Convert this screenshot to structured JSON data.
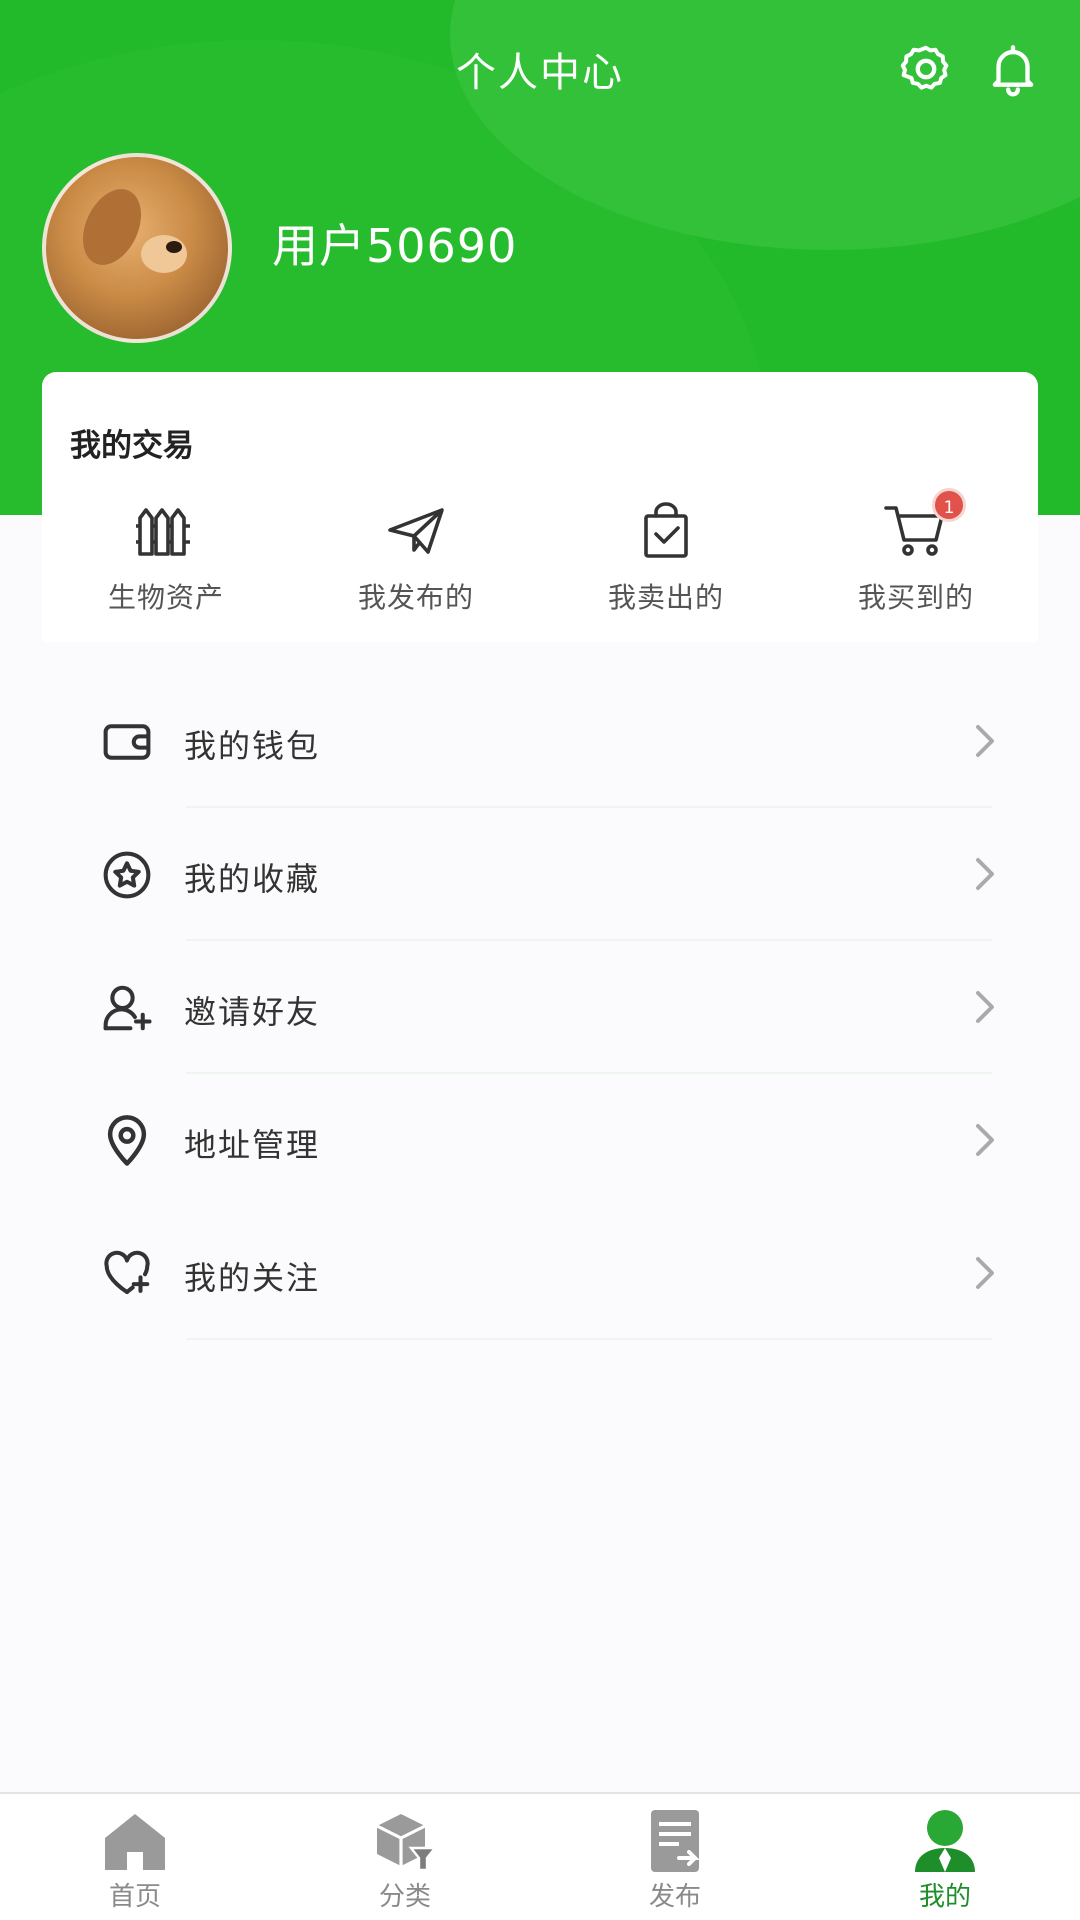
{
  "header": {
    "title": "个人中心",
    "settings_icon": "gear-icon",
    "notification_icon": "bell-icon"
  },
  "profile": {
    "username": "用户50690",
    "avatar": "dog-photo-avatar"
  },
  "trade": {
    "title": "我的交易",
    "items": [
      {
        "label": "生物资产",
        "icon": "fence-icon"
      },
      {
        "label": "我发布的",
        "icon": "paper-plane-icon"
      },
      {
        "label": "我卖出的",
        "icon": "shopping-bag-check-icon"
      },
      {
        "label": "我买到的",
        "icon": "cart-icon",
        "badge": "1"
      }
    ]
  },
  "menu": {
    "items": [
      {
        "label": "我的钱包",
        "icon": "wallet-icon"
      },
      {
        "label": "我的收藏",
        "icon": "star-circle-icon"
      },
      {
        "label": "邀请好友",
        "icon": "add-user-icon"
      },
      {
        "label": "地址管理",
        "icon": "location-pin-icon"
      },
      {
        "label": "我的关注",
        "icon": "heart-plus-icon"
      }
    ]
  },
  "tabbar": {
    "items": [
      {
        "label": "首页",
        "icon": "home-icon",
        "active": false
      },
      {
        "label": "分类",
        "icon": "category-box-icon",
        "active": false
      },
      {
        "label": "发布",
        "icon": "publish-icon",
        "active": false
      },
      {
        "label": "我的",
        "icon": "person-icon",
        "active": true
      }
    ]
  },
  "colors": {
    "primary": "#22b92b",
    "badge": "#e0524a",
    "tab_inactive": "#8a8a8a",
    "tab_active": "#1e8e2a"
  }
}
